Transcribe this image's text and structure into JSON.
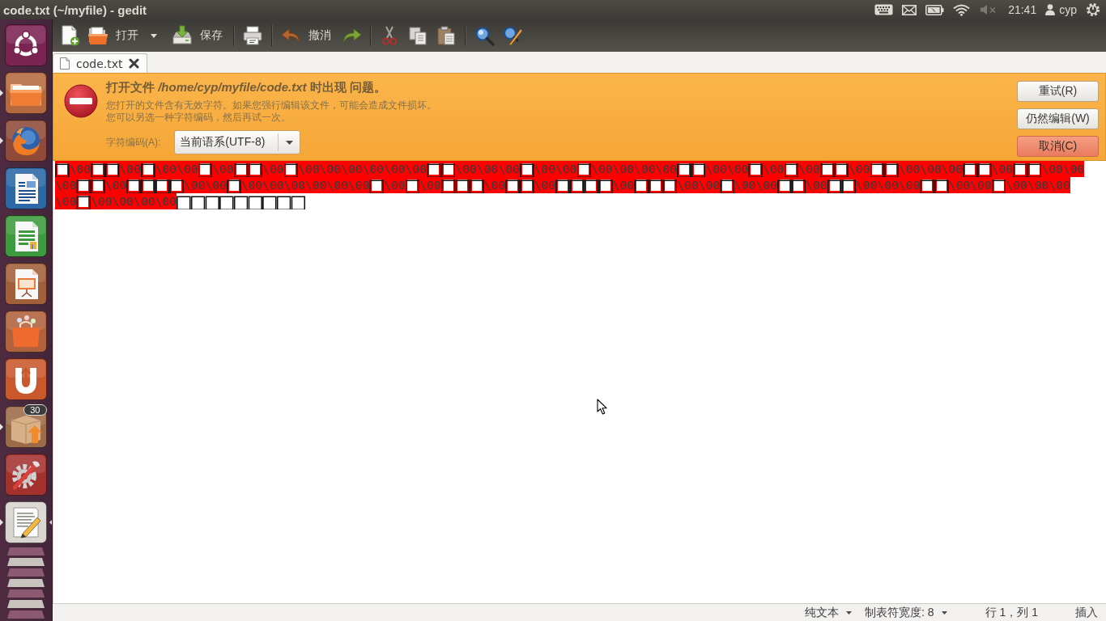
{
  "top_panel": {
    "title": "code.txt (~/myfile) - gedit",
    "indicators": [
      {
        "kind": "keyboard"
      },
      {
        "kind": "mail"
      },
      {
        "kind": "battery"
      },
      {
        "kind": "wifi"
      }
    ],
    "volume": {
      "muted": true
    },
    "clock": "21:41",
    "user": "cyp"
  },
  "launcher": {
    "items": [
      {
        "kind": "dash",
        "running": false,
        "focused": false
      },
      {
        "kind": "files",
        "running": true,
        "focused": false
      },
      {
        "kind": "browser",
        "running": true,
        "focused": false
      },
      {
        "kind": "writer",
        "running": false,
        "focused": false
      },
      {
        "kind": "spreadsheet",
        "running": false,
        "focused": false
      },
      {
        "kind": "presentation",
        "running": false,
        "focused": false
      },
      {
        "kind": "store",
        "running": false,
        "focused": false
      },
      {
        "kind": "cloud",
        "running": false,
        "focused": false
      },
      {
        "kind": "updates",
        "running": true,
        "focused": false,
        "badge": "30"
      },
      {
        "kind": "settings",
        "running": false,
        "focused": false
      },
      {
        "kind": "editor",
        "running": true,
        "focused": true
      }
    ]
  },
  "toolbar": {
    "items": [
      {
        "kind": "new"
      },
      {
        "kind": "open",
        "label": "打开"
      },
      {
        "kind": "menu"
      },
      {
        "kind": "save",
        "label": "保存"
      },
      {
        "kind": "separator"
      },
      {
        "kind": "print"
      },
      {
        "kind": "separator"
      },
      {
        "kind": "undo",
        "label": "撤消"
      },
      {
        "kind": "redo"
      },
      {
        "kind": "separator"
      },
      {
        "kind": "cut"
      },
      {
        "kind": "copy"
      },
      {
        "kind": "paste"
      },
      {
        "kind": "separator"
      },
      {
        "kind": "find"
      },
      {
        "kind": "replace"
      }
    ]
  },
  "tabs": [
    {
      "label": "code.txt",
      "selected": true
    }
  ],
  "infobar": {
    "title": "打开文件 */home/cyp/myfile/code.txt* 时出现 问题。",
    "message": [
      "您打开的文件含有无效字符。如果您强行编辑该文件，可能会造成文件损坏。",
      "您可以另选一种字符编码，然后再试一次。"
    ],
    "encoding_label": "字符编码(A):",
    "encoding_value": "当前语系(UTF-8)",
    "buttons": [
      {
        "label": "重试(R)",
        "default": false
      },
      {
        "label": "仍然编辑(W)",
        "default": false
      },
      {
        "label": "取消(C)",
        "default": true
      }
    ]
  },
  "document": {
    "lines": [
      {
        "segments": [
          {
            "text": "□\\00□□\\00□\\00\\00□\\00□□\\00□\\00\\00\\00\\00\\00\\00□□\\00\\00\\00□\\00\\00□\\00\\00\\00\\00□□\\00\\00□\\00□\\00□□\\00□□\\00\\00\\00□□\\00□□\\00\\00",
            "highlighted": true
          }
        ]
      },
      {
        "segments": [
          {
            "text": "\\00□□\\00□□□□\\00\\00□\\00\\00\\00\\00\\00\\00□\\00□\\00□□□\\00□□\\00□□□□\\00□□□\\00\\00□\\00\\00□□\\00□□\\00\\00\\00□□\\00\\00□\\00\\00\\00",
            "highlighted": true
          }
        ]
      },
      {
        "segments": [
          {
            "text": "\\00□\\00\\00\\00\\00",
            "highlighted": true
          },
          {
            "text": "□□□□□□□□□",
            "highlighted": false
          }
        ]
      }
    ]
  },
  "status_bar": {
    "items": [
      {
        "kind": "menu",
        "label": "纯文本"
      },
      {
        "kind": "menu",
        "label": "制表符宽度: 8"
      },
      {
        "kind": "text",
        "label": "行 1，列 1"
      },
      {
        "kind": "text",
        "label": "插入"
      }
    ]
  }
}
